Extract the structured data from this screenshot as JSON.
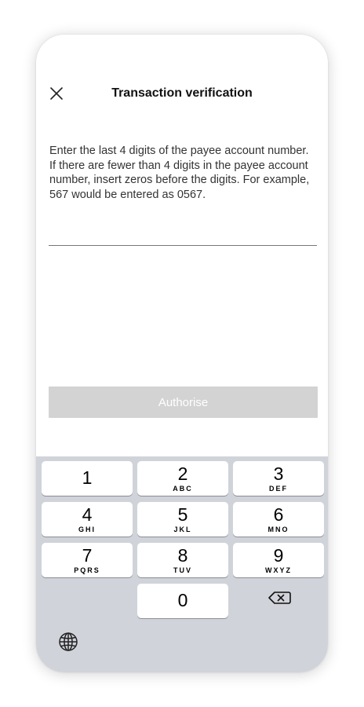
{
  "header": {
    "title": "Transaction verification",
    "close_icon": "close-icon"
  },
  "content": {
    "instructions": "Enter the last 4 digits of the payee account number. If there are fewer than 4 digits in the payee account number, insert zeros before the digits. For example, 567 would be entered as 0567.",
    "input_value": ""
  },
  "actions": {
    "authorise_label": "Authorise",
    "authorise_enabled": false
  },
  "keypad": {
    "keys": [
      {
        "digit": "1",
        "letters": ""
      },
      {
        "digit": "2",
        "letters": "ABC"
      },
      {
        "digit": "3",
        "letters": "DEF"
      },
      {
        "digit": "4",
        "letters": "GHI"
      },
      {
        "digit": "5",
        "letters": "JKL"
      },
      {
        "digit": "6",
        "letters": "MNO"
      },
      {
        "digit": "7",
        "letters": "PQRS"
      },
      {
        "digit": "8",
        "letters": "TUV"
      },
      {
        "digit": "9",
        "letters": "WXYZ"
      },
      {
        "digit": "0",
        "letters": ""
      }
    ],
    "backspace_icon": "backspace-icon",
    "globe_icon": "globe-icon"
  },
  "colors": {
    "button_disabled": "#d3d3d3",
    "keyboard_bg": "#d0d3d9",
    "key_bg": "#ffffff"
  }
}
